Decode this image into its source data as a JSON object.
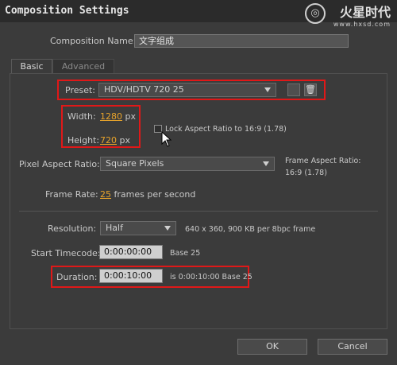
{
  "window": {
    "title": "Composition Settings"
  },
  "watermark": {
    "brand": "火星时代",
    "url": "www.hxsd.com"
  },
  "composition_name": {
    "label": "Composition Name:",
    "value": "文字组成"
  },
  "tabs": [
    {
      "label": "Basic"
    },
    {
      "label": "Advanced"
    }
  ],
  "preset": {
    "label": "Preset:",
    "value": "HDV/HDTV 720 25"
  },
  "width": {
    "label": "Width:",
    "value": "1280",
    "unit": "px"
  },
  "height": {
    "label": "Height:",
    "value": "720",
    "unit": "px"
  },
  "lock_aspect": {
    "label": "Lock Aspect Ratio to 16:9 (1.78)",
    "checked": false
  },
  "pixel_aspect": {
    "label": "Pixel Aspect Ratio:",
    "value": "Square Pixels",
    "frame_aspect_label": "Frame Aspect Ratio:",
    "frame_aspect_value": "16:9 (1.78)"
  },
  "frame_rate": {
    "label": "Frame Rate:",
    "value": "25",
    "unit": "frames per second"
  },
  "resolution": {
    "label": "Resolution:",
    "value": "Half",
    "info": "640 x 360, 900 KB per 8bpc frame"
  },
  "start_timecode": {
    "label": "Start Timecode:",
    "value": "0:00:00:00",
    "base": "Base 25"
  },
  "duration": {
    "label": "Duration:",
    "value": "0:00:10:00",
    "info": "is 0:00:10:00  Base 25"
  },
  "buttons": {
    "ok": "OK",
    "cancel": "Cancel"
  },
  "colors": {
    "background": "#3b3b3b",
    "highlight": "#e01818",
    "value_orange": "#e9a42b"
  }
}
